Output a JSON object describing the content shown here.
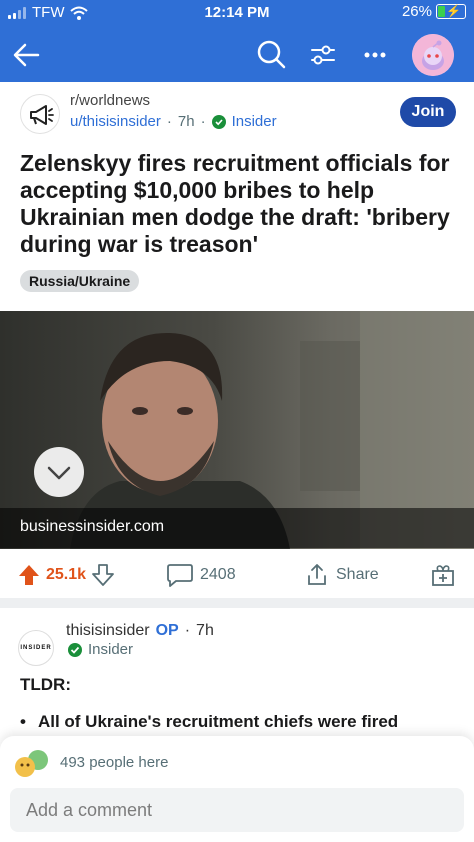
{
  "status": {
    "carrier": "TFW",
    "time": "12:14 PM",
    "battery": "26%",
    "battery_level": 0.26
  },
  "post": {
    "subreddit": "r/worldnews",
    "author": "u/thisisinsider",
    "age": "7h",
    "author_flair": "Insider",
    "join_label": "Join",
    "title": "Zelenskyy fires recruitment officials for accepting $10,000 bribes to help Ukrainian men dodge the draft: 'bribery during war is treason'",
    "flair": "Russia/Ukraine",
    "link_domain": "businessinsider.com",
    "score": "25.1k",
    "comments": "2408",
    "share_label": "Share"
  },
  "comment": {
    "avatar_text": "INSIDER",
    "author": "thisisinsider",
    "op_badge": "OP",
    "age": "7h",
    "flair": "Insider",
    "tldr": "TLDR:",
    "bullet_marker": "•",
    "bullet_text": "All of Ukraine's recruitment chiefs were fired"
  },
  "bottom": {
    "people_here": "493 people here",
    "add_comment_placeholder": "Add a comment"
  },
  "colors": {
    "header_blue": "#2f6fd6",
    "join_blue": "#1f4aa8",
    "upvote_orange": "#e0531a",
    "verified_green": "#1a8f3a"
  }
}
